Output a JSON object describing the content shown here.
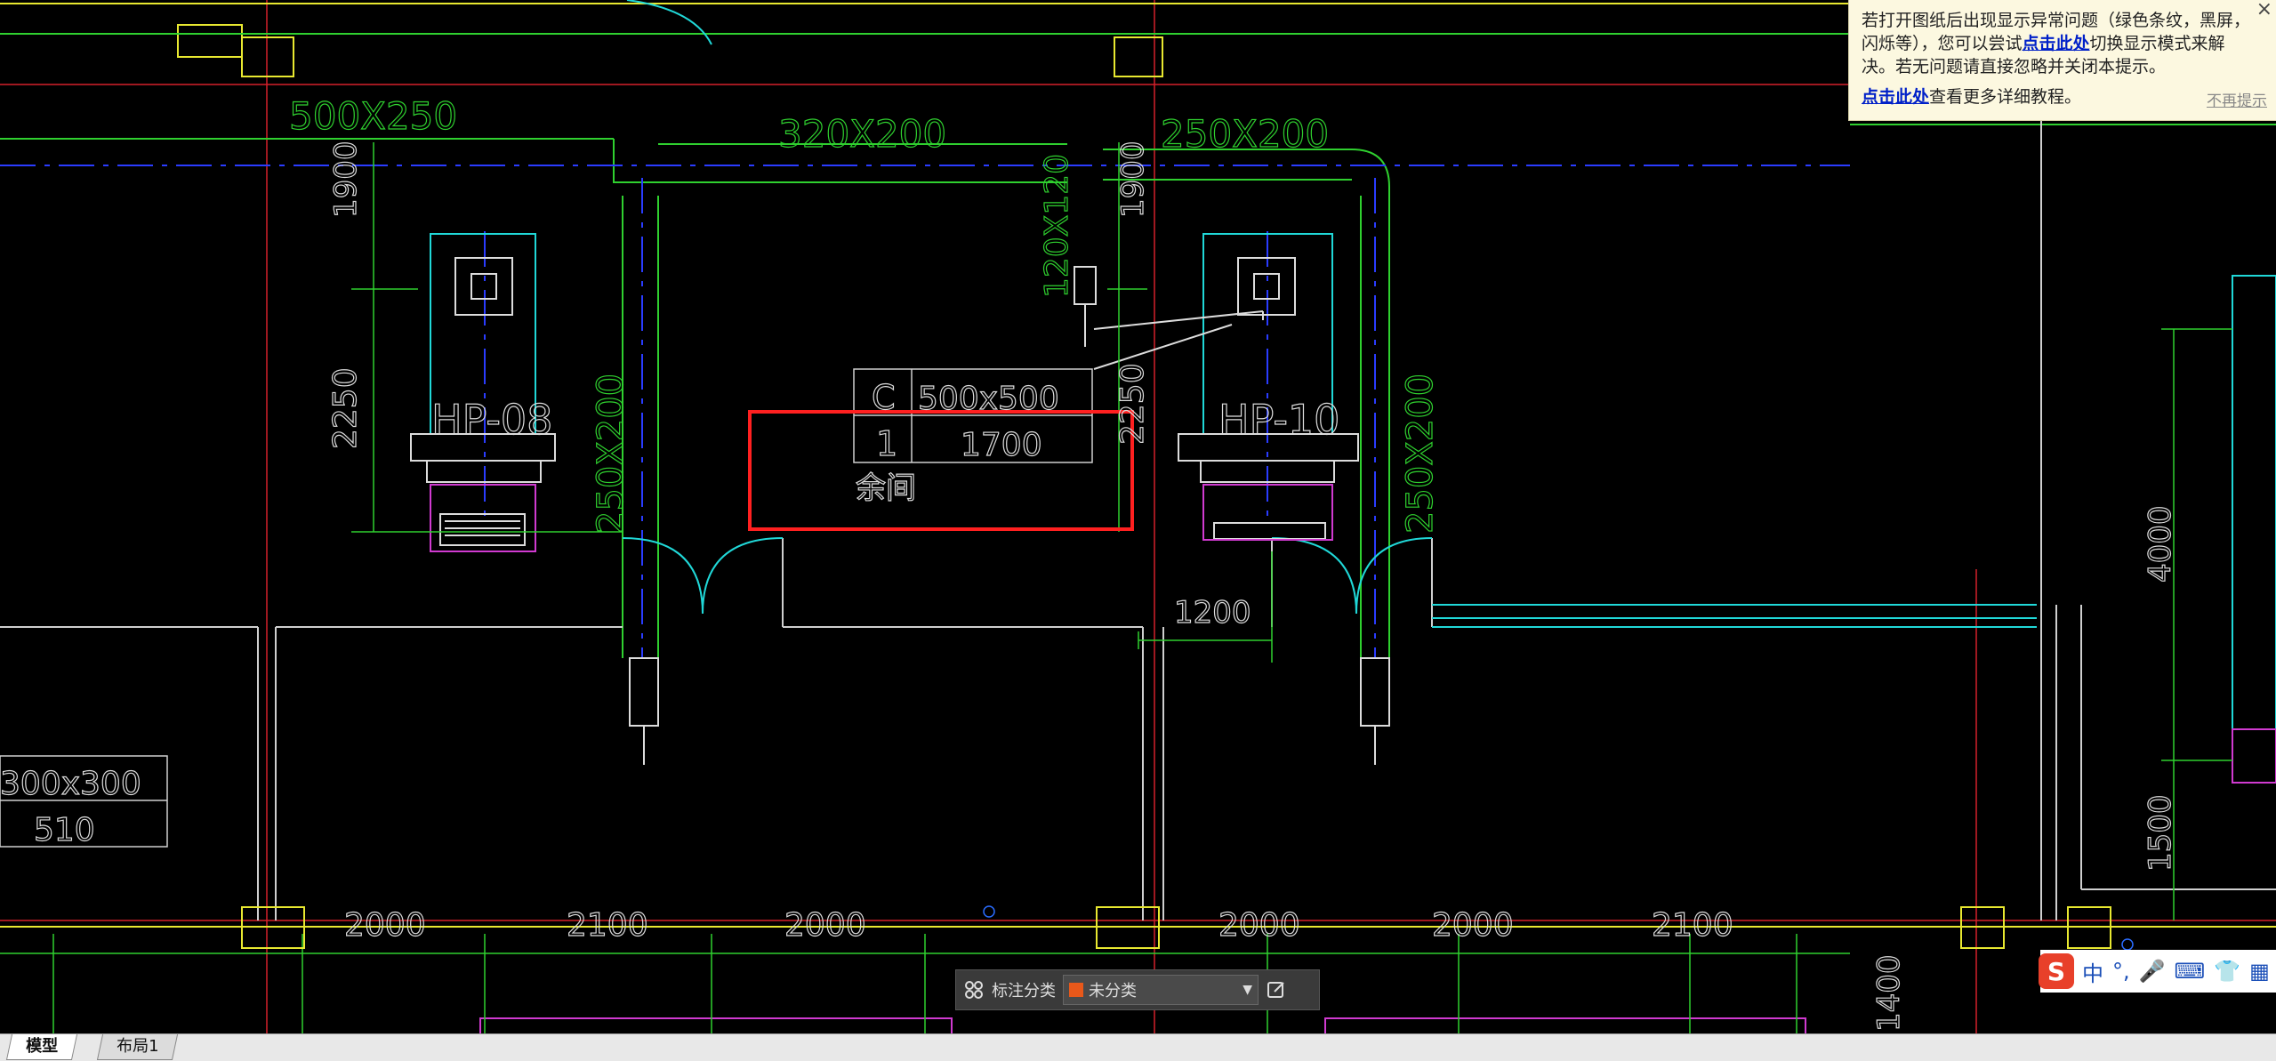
{
  "drawing": {
    "duct_labels": [
      "500X250",
      "320X200",
      "250X200",
      "250X200",
      "250X200",
      "120X120"
    ],
    "unit_labels": [
      "HP-08",
      "HP-10"
    ],
    "vertical_dims": [
      "1900",
      "1900",
      "2250",
      "2250",
      "4000",
      "1500",
      "1400"
    ],
    "bottom_dims": [
      "2000",
      "2100",
      "2000",
      "2000",
      "2000",
      "2100"
    ],
    "dim_1200": "1200",
    "tag_table": {
      "row1_left": "C",
      "row1_right": "500x500",
      "row2_left": "1",
      "row2_right": "1700",
      "note": "余间"
    },
    "left_table": {
      "row1": "300x300",
      "row2": "510"
    }
  },
  "notice": {
    "text_part1": "若打开图纸后出现显示异常问题（绿色条纹，黑屏，闪烁等），您可以尝试",
    "link1": "点击此处",
    "text_part2": "切换显示模式来解决。若无问题请直接忽略并关闭本提示。",
    "link2": "点击此处",
    "text_part3": "查看更多详细教程。",
    "dismiss": "不再提示",
    "close": "×"
  },
  "annotation_bar": {
    "label": "标注分类",
    "selected": "未分类",
    "swatch_color": "#e8581a"
  },
  "ime": {
    "logo": "S",
    "lang": "中",
    "punct": "°,",
    "mic": "🎤",
    "keyboard": "⌨",
    "skin": "👕",
    "menu": "▦"
  },
  "tabs": [
    {
      "label": "模型",
      "active": true
    },
    {
      "label": "布局1",
      "active": false
    }
  ]
}
